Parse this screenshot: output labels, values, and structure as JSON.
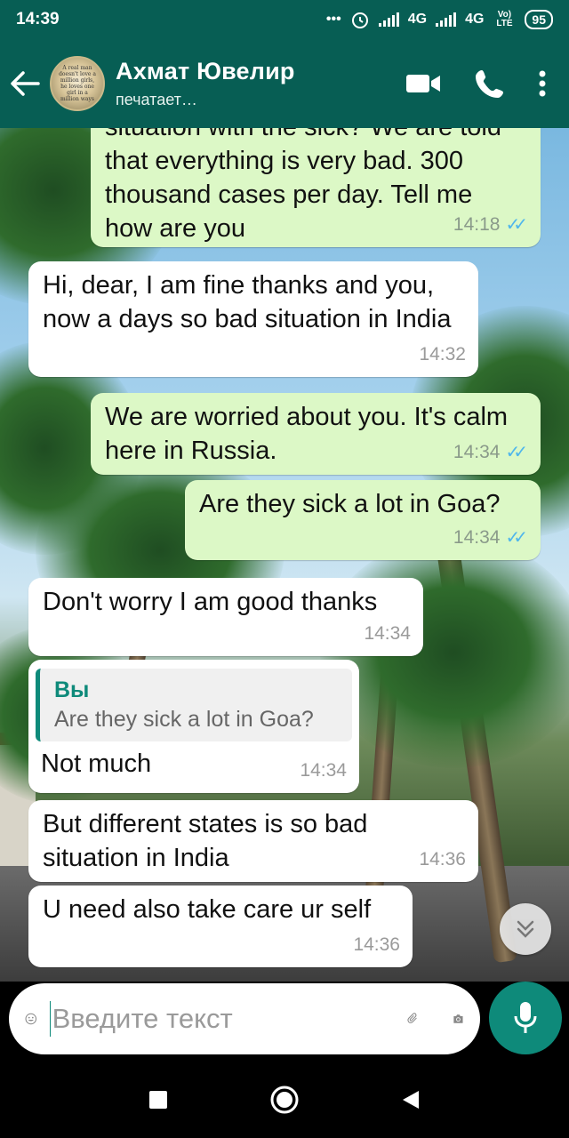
{
  "status_bar": {
    "time": "14:39",
    "dots": "•••",
    "network1": "4G",
    "network2": "4G",
    "volte": "Vo) LTE",
    "battery": "95"
  },
  "header": {
    "contact_name": "Ахмат Ювелир",
    "contact_status": "печатает…",
    "avatar_text": "A real man doesn't love a million girls, he loves one girl in a million ways"
  },
  "messages": [
    {
      "id": "m1",
      "direction": "out",
      "text": "situation with the sick? We are told that everything is very bad. 300 thousand cases per day. Tell me how are you",
      "time": "14:18",
      "read": true
    },
    {
      "id": "m2",
      "direction": "in",
      "text": "Hi, dear, I am fine thanks and you, now a days so bad situation in India",
      "time": "14:32"
    },
    {
      "id": "m3",
      "direction": "out",
      "text": "We are worried about you. It's calm here in Russia.",
      "time": "14:34",
      "read": true
    },
    {
      "id": "m4",
      "direction": "out",
      "text": "Are they sick a lot in Goa?",
      "time": "14:34",
      "read": true
    },
    {
      "id": "m5",
      "direction": "in",
      "text": "Don't worry I am good thanks",
      "time": "14:34"
    },
    {
      "id": "m6",
      "direction": "in",
      "text": "Not much",
      "time": "14:34",
      "quote_author": "Вы",
      "quote_text": "Are they sick a lot in Goa?"
    },
    {
      "id": "m7",
      "direction": "in",
      "text": "But different states is so bad situation in India",
      "time": "14:36"
    },
    {
      "id": "m8",
      "direction": "in",
      "text": "U need also take care ur self",
      "time": "14:36"
    }
  ],
  "input": {
    "placeholder": "Введите текст"
  },
  "colors": {
    "header": "#075e54",
    "accent": "#0e8a7a",
    "outgoing_bubble": "#dcf8c6",
    "incoming_bubble": "#ffffff",
    "read_ticks": "#4fb6ec"
  },
  "icons": [
    "back-arrow-icon",
    "video-call-icon",
    "phone-icon",
    "more-options-icon",
    "emoji-icon",
    "attach-icon",
    "camera-icon",
    "mic-icon",
    "scroll-down-icon",
    "nav-recents-icon",
    "nav-home-icon",
    "nav-back-icon"
  ]
}
